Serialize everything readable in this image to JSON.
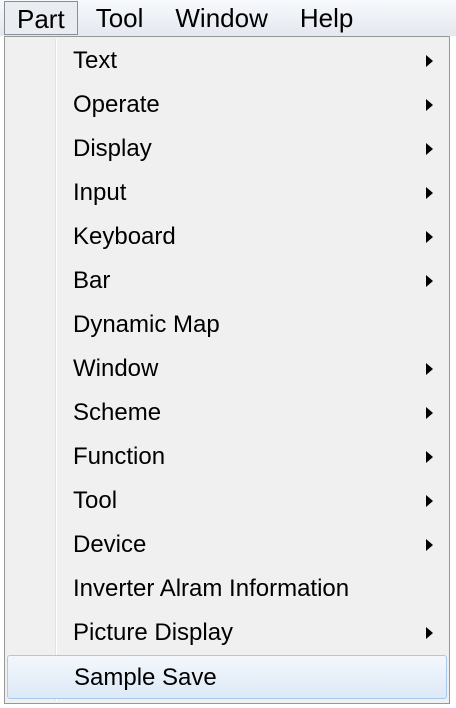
{
  "menubar": {
    "items": [
      {
        "label": "Part",
        "active": true
      },
      {
        "label": "Tool",
        "active": false
      },
      {
        "label": "Window",
        "active": false
      },
      {
        "label": "Help",
        "active": false
      }
    ]
  },
  "dropdown": {
    "items": [
      {
        "label": "Text",
        "submenu": true
      },
      {
        "label": "Operate",
        "submenu": true
      },
      {
        "label": "Display",
        "submenu": true
      },
      {
        "label": "Input",
        "submenu": true
      },
      {
        "label": "Keyboard",
        "submenu": true
      },
      {
        "label": "Bar",
        "submenu": true
      },
      {
        "label": "Dynamic Map",
        "submenu": false
      },
      {
        "label": "Window",
        "submenu": true
      },
      {
        "label": "Scheme",
        "submenu": true
      },
      {
        "label": "Function",
        "submenu": true
      },
      {
        "label": "Tool",
        "submenu": true
      },
      {
        "label": "Device",
        "submenu": true
      },
      {
        "label": "Inverter Alram Information",
        "submenu": false
      },
      {
        "label": "Picture Display",
        "submenu": true
      },
      {
        "label": "Sample Save",
        "submenu": false,
        "highlighted": true
      }
    ]
  },
  "colors": {
    "menu_background": "#f0f0f0",
    "highlight_border": "#a8c8ec"
  }
}
